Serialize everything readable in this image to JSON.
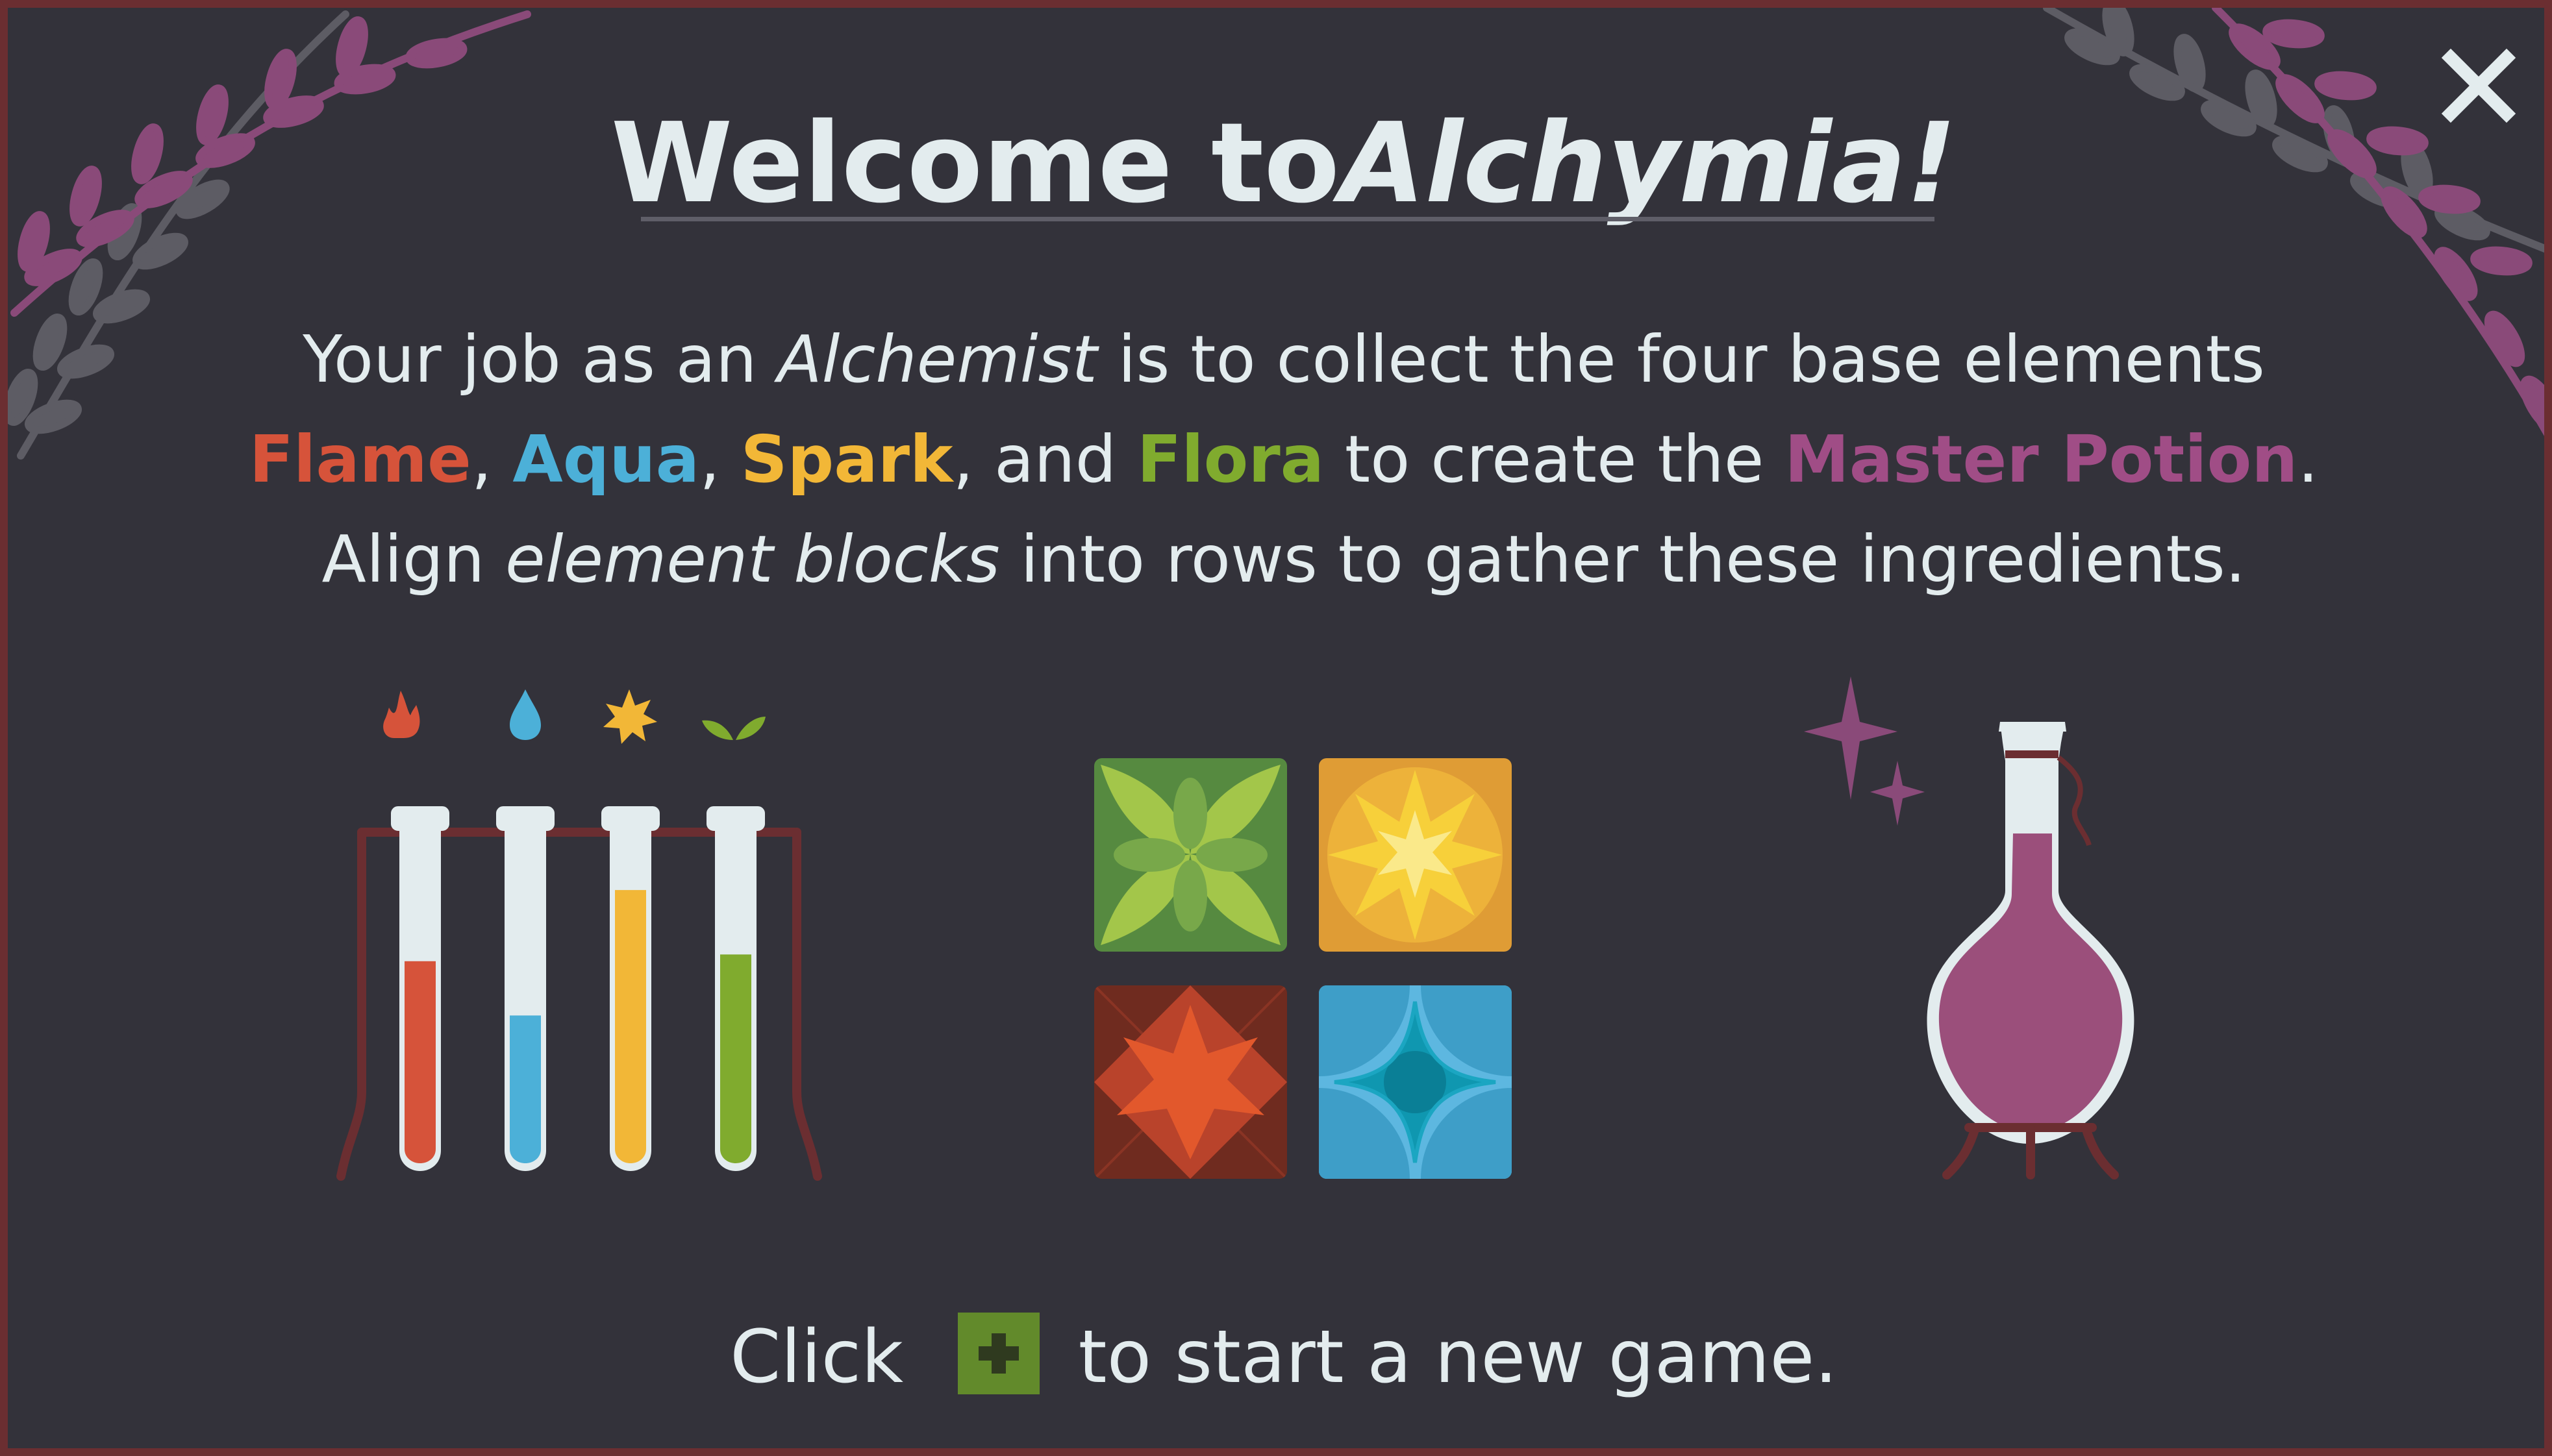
{
  "dialog": {
    "title_prefix": "Welcome to ",
    "title_game": "Alchymia!",
    "close_label": "close"
  },
  "intro": {
    "line1_before": "Your job as an ",
    "line1_role": "Alchemist",
    "line1_after": " is to collect the four base elements",
    "elements": {
      "flame": "Flame",
      "aqua": "Aqua",
      "spark": "Spark",
      "flora": "Flora"
    },
    "sep1": ", ",
    "sep2": ", ",
    "sep3": ", and ",
    "line2_mid": " to create the ",
    "potion": "Master Potion",
    "line2_end": ".",
    "line3_before": "Align ",
    "line3_term": "element blocks",
    "line3_after": " into rows to gather these ingredients."
  },
  "illustrations": {
    "element_icons": [
      "flame-icon",
      "water-drop-icon",
      "spark-star-icon",
      "leaf-icon"
    ],
    "test_tube_levels": [
      0.6,
      0.44,
      0.81,
      0.62
    ],
    "tiles": [
      "flora-tile",
      "spark-tile",
      "flame-tile",
      "aqua-tile"
    ],
    "potion": "master-potion-flask-icon"
  },
  "footer": {
    "before": "Click ",
    "after": "to start a new game.",
    "button_icon": "plus-icon"
  },
  "colors": {
    "background": "#33323a",
    "border": "#6b2e31",
    "text": "#e3ecee",
    "flame": "#d6533a",
    "aqua": "#4cb0d8",
    "spark": "#f2b737",
    "flora": "#80ab2e",
    "master": "#a04d86",
    "button": "#628a2b"
  }
}
